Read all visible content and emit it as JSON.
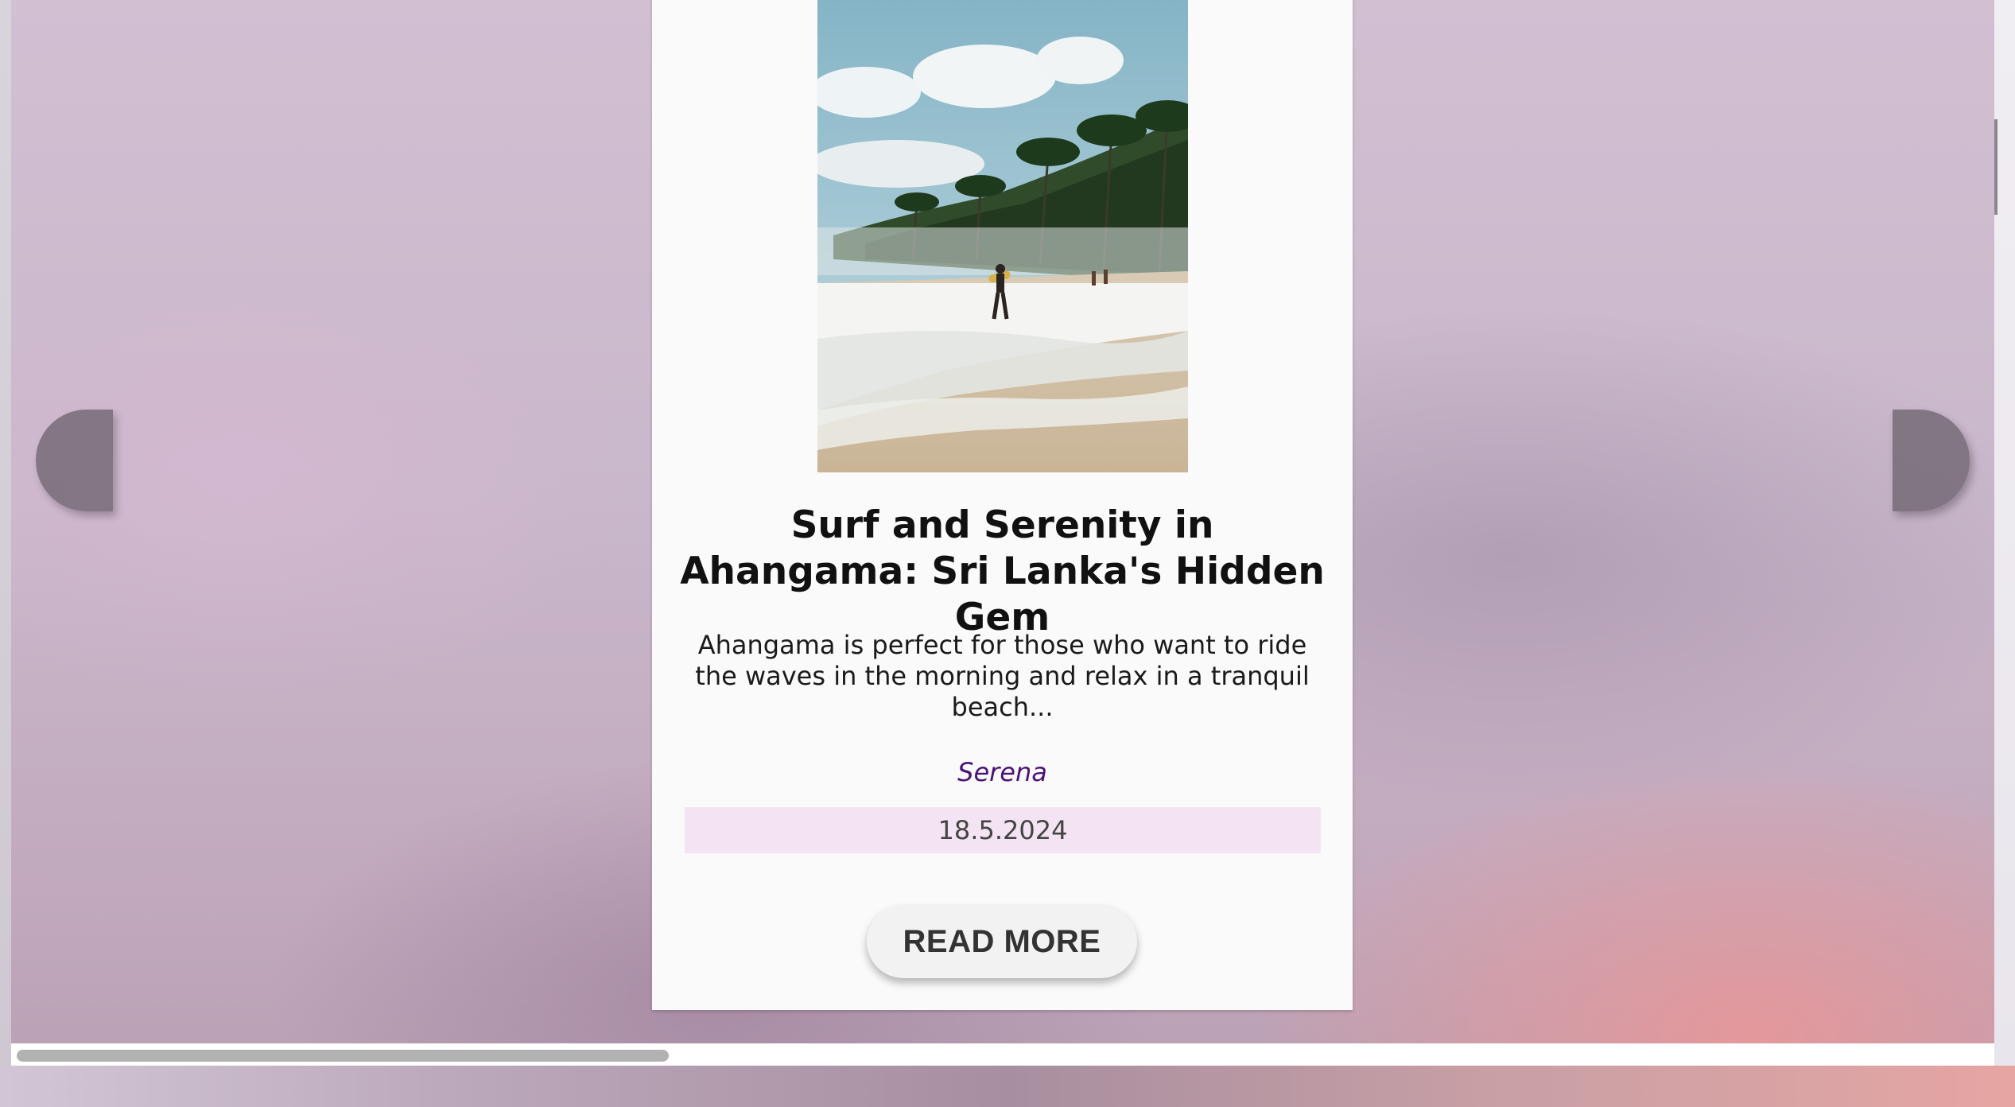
{
  "post": {
    "title": "Surf and Serenity in Ahangama: Sri Lanka's Hidden Gem",
    "excerpt": "Ahangama is perfect for those who want to ride the waves in the morning and relax in a tranquil beach...",
    "author": "Serena",
    "date": "18.5.2024",
    "read_more_label": "READ MORE",
    "image_alt": "surfer walking on a palm-lined beach"
  },
  "carousel": {
    "prev_icon": "chevron-left-icon",
    "next_icon": "chevron-right-icon"
  },
  "colors": {
    "card_bg": "#fafafa",
    "author": "#4a1275",
    "date_bg": "#f4e4f3",
    "button_bg": "#f2f2f2",
    "nav_button": "#6e6470"
  }
}
